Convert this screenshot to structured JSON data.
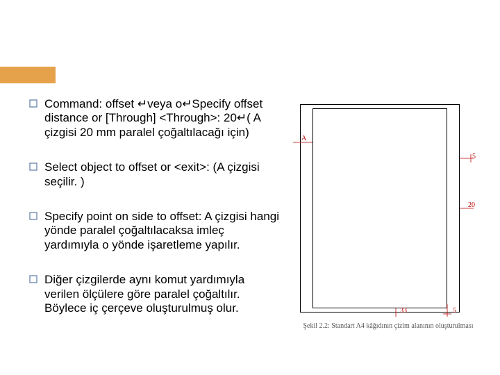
{
  "bullets": [
    "Command: offset ↵veya o↵Specify offset distance or [Through] <Through>: 20↵( A çizgisi 20 mm paralel çoğaltılacağı için)",
    "Select object to offset or <exit>: (A çizgisi seçilir. )",
    "Specify point on side to offset: A çizgisi hangi yönde paralel çoğaltılacaksa imleç yardımıyla o yönde işaretleme yapılır.",
    "Diğer çizgilerde aynı komut yardımıyla verilen ölçülere göre paralel çoğaltılır. Böylece iç çerçeve oluşturulmuş olur."
  ],
  "figure": {
    "labels": {
      "A": "A",
      "d5a": "5",
      "d20": "20",
      "d33": "33",
      "d5b": "5"
    },
    "caption": "Şekil 2.2: Standart A4 kâğıdının çizim alanının oluşturulması"
  }
}
